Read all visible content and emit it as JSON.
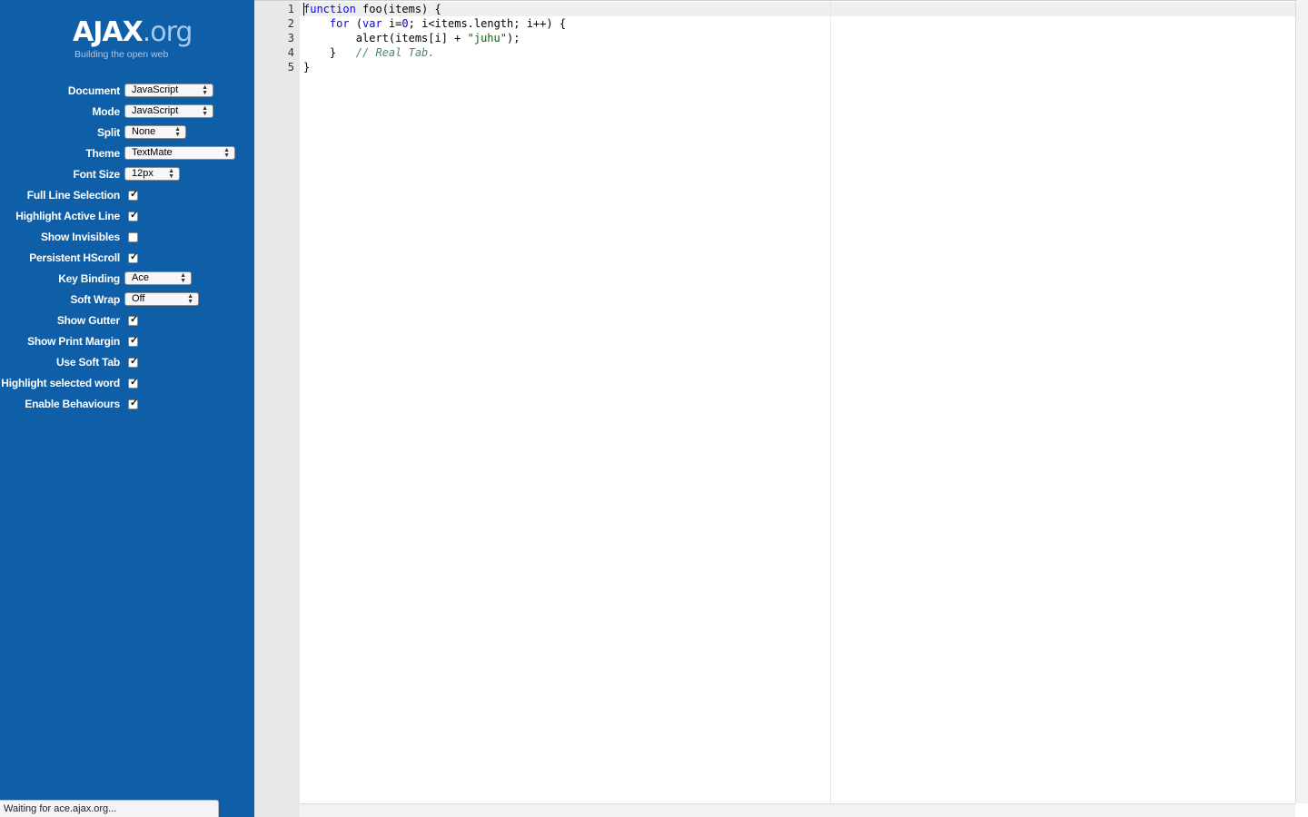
{
  "logo": {
    "word_bold": "AJAX",
    "word_tld": ".org",
    "tagline": "Building the open web"
  },
  "options": [
    {
      "label": "Document",
      "type": "select",
      "value": "JavaScript"
    },
    {
      "label": "Mode",
      "type": "select",
      "value": "JavaScript"
    },
    {
      "label": "Split",
      "type": "select",
      "value": "None"
    },
    {
      "label": "Theme",
      "type": "select",
      "value": "TextMate"
    },
    {
      "label": "Font Size",
      "type": "select",
      "value": "12px"
    },
    {
      "label": "Full Line Selection",
      "type": "checkbox",
      "checked": true
    },
    {
      "label": "Highlight Active Line",
      "type": "checkbox",
      "checked": true
    },
    {
      "label": "Show Invisibles",
      "type": "checkbox",
      "checked": false
    },
    {
      "label": "Persistent HScroll",
      "type": "checkbox",
      "checked": true
    },
    {
      "label": "Key Binding",
      "type": "select",
      "value": "Ace"
    },
    {
      "label": "Soft Wrap",
      "type": "select",
      "value": "Off"
    },
    {
      "label": "Show Gutter",
      "type": "checkbox",
      "checked": true
    },
    {
      "label": "Show Print Margin",
      "type": "checkbox",
      "checked": true
    },
    {
      "label": "Use Soft Tab",
      "type": "checkbox",
      "checked": true
    },
    {
      "label": "Highlight selected word",
      "type": "checkbox",
      "checked": true
    },
    {
      "label": "Enable Behaviours",
      "type": "checkbox",
      "checked": true
    }
  ],
  "status_text": "Waiting for ace.ajax.org...",
  "editor": {
    "line_numbers": [
      "1",
      "2",
      "3",
      "4",
      "5"
    ],
    "code": {
      "l1_kw": "function",
      "l1_rest": " foo(items) {",
      "l2_indent": "    ",
      "l2_kw1": "for",
      "l2_p1": " (",
      "l2_kw2": "var",
      "l2_p2": " i=",
      "l2_num": "0",
      "l2_p3": "; i<items.length; i++) {",
      "l3_a": "        alert(items[i] + ",
      "l3_str": "\"juhu\"",
      "l3_b": ");",
      "l4_a": "    }   ",
      "l4_cmt": "// Real Tab.",
      "l5": "}"
    }
  },
  "colors": {
    "sidebar": "#0e5ea8",
    "gutter": "#e8e8e8",
    "keyword": "#0000ff",
    "string": "#036a07",
    "comment": "#4c886b"
  }
}
